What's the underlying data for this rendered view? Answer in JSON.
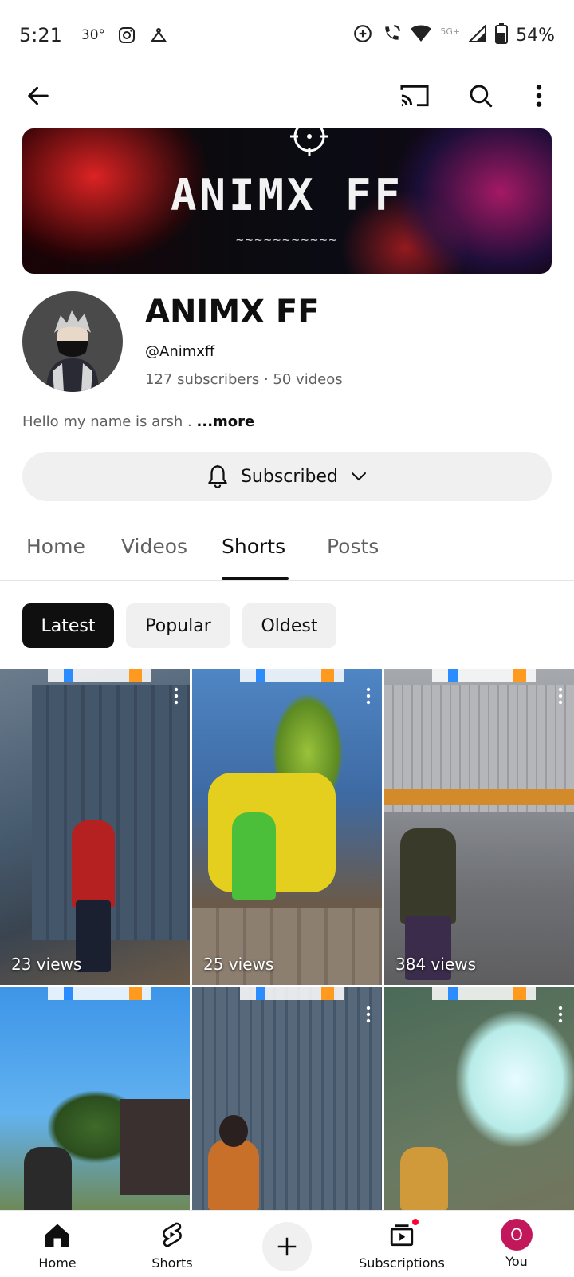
{
  "status_bar": {
    "time": "5:21",
    "temperature": "30°",
    "network_label": "5G+",
    "battery": "54%"
  },
  "icons": {
    "back": "arrow-left-icon",
    "cast": "cast-icon",
    "search": "search-icon",
    "more": "more-vert-icon",
    "bell": "bell-icon",
    "chevron": "chevron-down-icon"
  },
  "banner": {
    "title": "ANIMX FF",
    "tilde": "~~~~~~~~~~~"
  },
  "channel": {
    "name": "ANIMX FF",
    "handle": "@Animxff",
    "stats": "127 subscribers · 50 videos",
    "description": "Hello my name is arsh .",
    "more_label": "...more",
    "subscribe_label": "Subscribed"
  },
  "tabs": {
    "home": "Home",
    "videos": "Videos",
    "shorts": "Shorts",
    "posts": "Posts",
    "active": "Shorts"
  },
  "chips": {
    "latest": "Latest",
    "popular": "Popular",
    "oldest": "Oldest",
    "active": "Latest"
  },
  "shorts": [
    {
      "views": "23 views",
      "bg": "#4a5f74"
    },
    {
      "views": "25 views",
      "bg": "#4b7ab5"
    },
    {
      "views": "384 views",
      "bg": "#8d8f93"
    },
    {
      "views": "",
      "bg": "#5aa0dc"
    },
    {
      "views": "",
      "bg": "#5c6b7a"
    },
    {
      "views": "",
      "bg": "#5f6a4a"
    }
  ],
  "bottom_nav": {
    "home": "Home",
    "shorts": "Shorts",
    "subscriptions": "Subscriptions",
    "you": "You",
    "you_initial": "O"
  },
  "colors": {
    "accent_red": "#ff0033",
    "you_avatar": "#c2185b"
  }
}
